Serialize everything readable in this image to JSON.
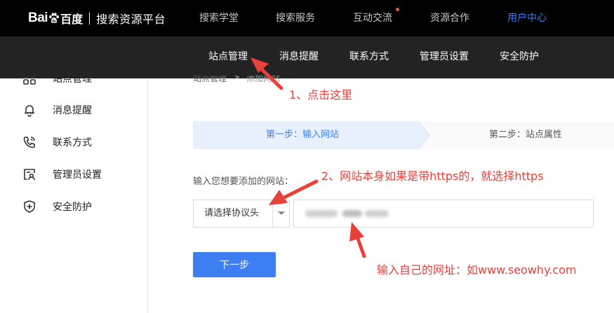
{
  "header": {
    "brand": "Bai",
    "brand_suffix": "百度",
    "platform": "搜索资源平台",
    "nav": [
      {
        "label": "搜索学堂"
      },
      {
        "label": "搜索服务"
      },
      {
        "label": "互动交流"
      },
      {
        "label": "资源合作"
      },
      {
        "label": "用户中心",
        "active": true
      }
    ]
  },
  "submenu": {
    "items": [
      {
        "label": "站点管理"
      },
      {
        "label": "消息提醒"
      },
      {
        "label": "联系方式"
      },
      {
        "label": "管理员设置"
      },
      {
        "label": "安全防护"
      }
    ]
  },
  "sidebar": {
    "items": [
      {
        "label": "站点管理",
        "icon": "site-grid-icon"
      },
      {
        "label": "消息提醒",
        "icon": "bell-icon"
      },
      {
        "label": "联系方式",
        "icon": "phone-icon"
      },
      {
        "label": "管理员设置",
        "icon": "admin-id-icon"
      },
      {
        "label": "安全防护",
        "icon": "shield-plus-icon"
      }
    ]
  },
  "breadcrumb": {
    "parent": "站点管理",
    "separator": ">",
    "current": "添加网站"
  },
  "steps": {
    "step1": "第一步：输入网站",
    "step2": "第二步：站点属性"
  },
  "form": {
    "label": "输入您想要添加的网站：",
    "protocol_selected": "请选择协议头",
    "url_value": "",
    "next_button": "下一步"
  },
  "annotations": {
    "note1": "1、点击这里",
    "note2": "2、网站本身如果是带https的，就选择https",
    "note3": "输入自己的网址：如www.seowhy.com"
  },
  "colors": {
    "accent": "#3d7ef2",
    "annotation_red": "#e8403a",
    "header_bg": "#000000",
    "submenu_bg": "#232323",
    "step_active_bg": "#e8f0fd"
  }
}
